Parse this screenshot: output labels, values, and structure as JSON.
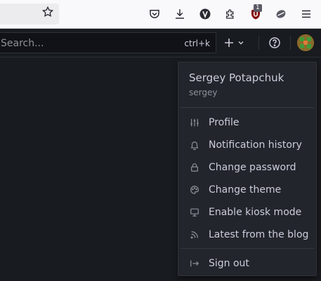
{
  "browser": {
    "extension_badge": "1"
  },
  "app_bar": {
    "search_placeholder": "Search...",
    "search_shortcut": "ctrl+k",
    "new_icon": "plus-icon"
  },
  "user_menu": {
    "name": "Sergey Potapchuk",
    "login": "sergey",
    "items": [
      {
        "label": "Profile",
        "icon": "sliders-icon"
      },
      {
        "label": "Notification history",
        "icon": "bell-icon"
      },
      {
        "label": "Change password",
        "icon": "lock-icon"
      },
      {
        "label": "Change theme",
        "icon": "palette-icon"
      },
      {
        "label": "Enable kiosk mode",
        "icon": "monitor-icon"
      },
      {
        "label": "Latest from the blog",
        "icon": "rss-icon"
      }
    ],
    "sign_out": {
      "label": "Sign out",
      "icon": "sign-out-icon"
    }
  },
  "colors": {
    "page_bg": "#181b1f",
    "menu_bg": "#22252b",
    "text_primary": "#ccccdc",
    "text_secondary": "#8e9099"
  }
}
